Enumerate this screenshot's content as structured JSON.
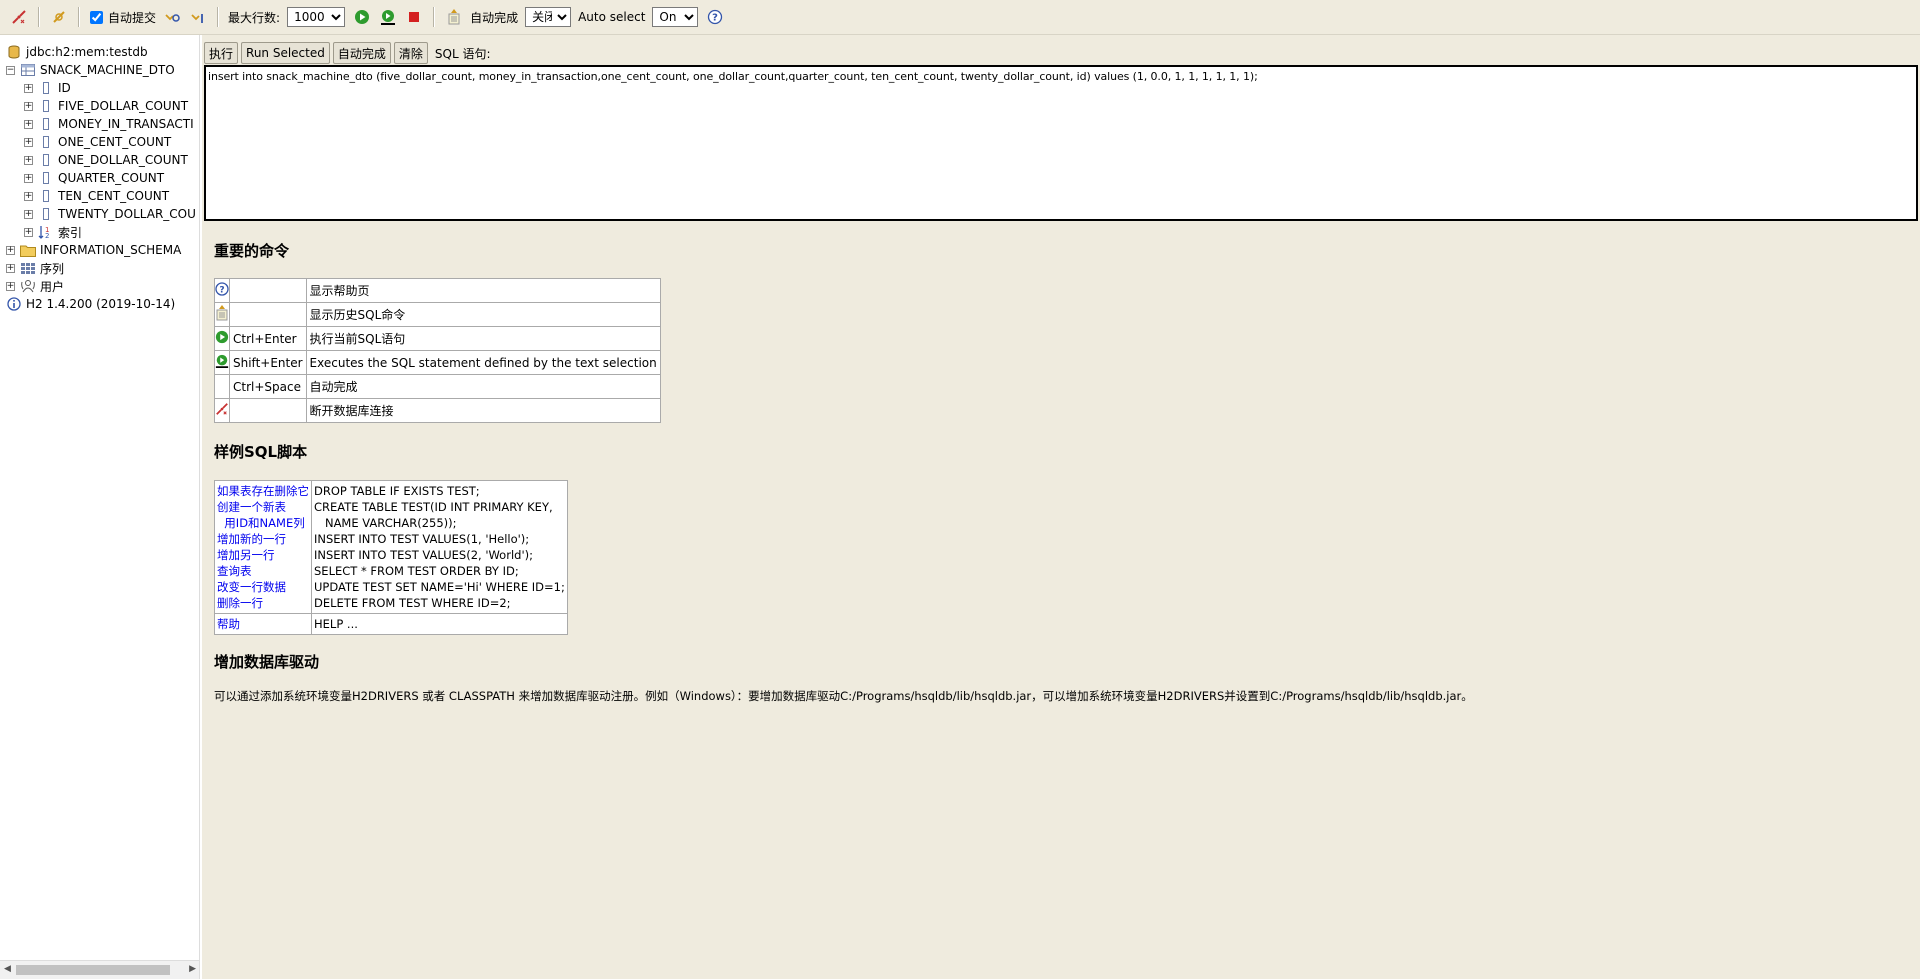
{
  "toolbar": {
    "auto_commit_label": "自动提交",
    "max_rows_label": "最大行数:",
    "max_rows_value": "1000",
    "auto_complete_label": "自动完成",
    "auto_complete_value": "关闭",
    "auto_select_label": "Auto select",
    "auto_select_value": "On",
    "colors": {
      "run": "#2e9b2e",
      "stop": "#d42020",
      "disconnect": "#c83232"
    }
  },
  "tree": {
    "connection": "jdbc:h2:mem:testdb",
    "table": "SNACK_MACHINE_DTO",
    "columns": [
      "ID",
      "FIVE_DOLLAR_COUNT",
      "MONEY_IN_TRANSACTI",
      "ONE_CENT_COUNT",
      "ONE_DOLLAR_COUNT",
      "QUARTER_COUNT",
      "TEN_CENT_COUNT",
      "TWENTY_DOLLAR_COU"
    ],
    "indexes": "索引",
    "information_schema": "INFORMATION_SCHEMA",
    "sequences": "序列",
    "users": "用户",
    "version": "H2 1.4.200 (2019-10-14)"
  },
  "query": {
    "execute_label": "执行",
    "run_selected_label": "Run Selected",
    "auto_complete_label": "自动完成",
    "clear_label": "清除",
    "sql_label": "SQL 语句:",
    "sql_text": "insert into snack_machine_dto (five_dollar_count, money_in_transaction,one_cent_count, one_dollar_count,quarter_count, ten_cent_count, twenty_dollar_count, id) values (1, 0.0, 1, 1, 1, 1, 1, 1);"
  },
  "help": {
    "important_title": "重要的命令",
    "commands": [
      {
        "icon": "help-icon",
        "key": "",
        "desc": "显示帮助页"
      },
      {
        "icon": "history-icon",
        "key": "",
        "desc": "显示历史SQL命令"
      },
      {
        "icon": "run-icon",
        "key": "Ctrl+Enter",
        "desc": "执行当前SQL语句"
      },
      {
        "icon": "run-selected-icon",
        "key": "Shift+Enter",
        "desc": "Executes the SQL statement defined by the text selection"
      },
      {
        "icon": "",
        "key": "Ctrl+Space",
        "desc": "自动完成"
      },
      {
        "icon": "disconnect-icon",
        "key": "",
        "desc": "断开数据库连接"
      }
    ],
    "sample_title": "样例SQL脚本",
    "sample_links": [
      "如果表存在删除它",
      "创建一个新表",
      "  用ID和NAME列",
      "增加新的一行",
      "增加另一行",
      "查询表",
      "改变一行数据",
      "删除一行"
    ],
    "sample_code": [
      "DROP TABLE IF EXISTS TEST;",
      "CREATE TABLE TEST(ID INT PRIMARY KEY,",
      "   NAME VARCHAR(255));",
      "INSERT INTO TEST VALUES(1, 'Hello');",
      "INSERT INTO TEST VALUES(2, 'World');",
      "SELECT * FROM TEST ORDER BY ID;",
      "UPDATE TEST SET NAME='Hi' WHERE ID=1;",
      "DELETE FROM TEST WHERE ID=2;"
    ],
    "help_link": "帮助",
    "help_code": "HELP ...",
    "drivers_title": "增加数据库驱动",
    "drivers_text": "可以通过添加系统环境变量H2DRIVERS 或者 CLASSPATH 来增加数据库驱动注册。例如（Windows）：要增加数据库驱动C:/Programs/hsqldb/lib/hsqldb.jar，可以增加系统环境变量H2DRIVERS并设置到C:/Programs/hsqldb/lib/hsqldb.jar。"
  }
}
